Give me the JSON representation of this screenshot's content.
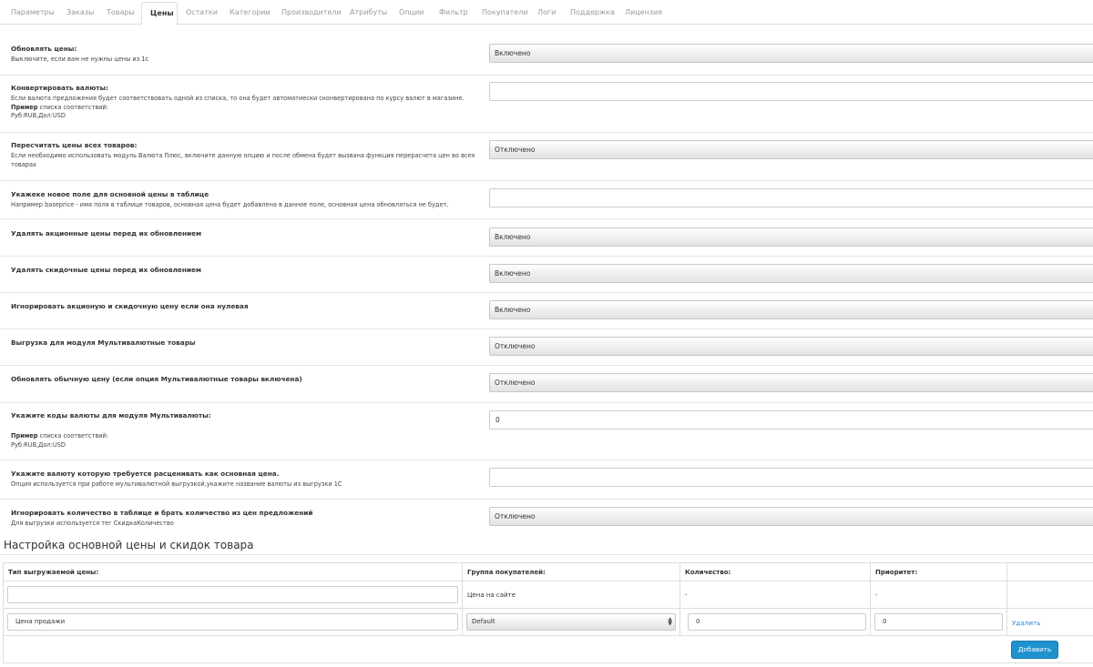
{
  "tabs": [
    "Параметры",
    "Заказы",
    "Товары",
    "Цены",
    "Остатки",
    "Категории",
    "Производители",
    "Атрибуты",
    "Опции",
    "Фильтр",
    "Покупатели",
    "Логи",
    "Поддержка",
    "Лицензия"
  ],
  "active_tab": "Цены",
  "settings": [
    {
      "label": "Обновлять цены:",
      "help": "Выключите, если вам не нужны цены из 1с",
      "control": "select",
      "value": "Включено"
    },
    {
      "label": "Конвертировать валюты:",
      "help": "Если валюта предложения будет соответствовать одной из списка, то она будет автоматиески сконвертирована по курсу валют в магазине.",
      "example_label": "Пример",
      "example_text": "списка соответствий:",
      "example_value": "Руб:RUB,Дол:USD",
      "control": "input",
      "value": ""
    },
    {
      "label": "Пересчитать цены всех товаров:",
      "help": "Если необходимо использовать модуль Валюта Плюс, включите данную опцию и после обмена будет вызвана функция перерасчета цен во всех товарах",
      "control": "select",
      "value": "Отключено"
    },
    {
      "label": "Укажеке новое поле для основной цены в таблице",
      "help": "Например baseprice - имя поля в таблице товаров, основная цена будет добавлена в данное поле, основная цена обновляться не будет.",
      "control": "input",
      "value": ""
    },
    {
      "label": "Удалять акционные цены перед их обновлением",
      "control": "select",
      "value": "Включено"
    },
    {
      "label": "Удалять скидочные цены перед их обновлением",
      "control": "select",
      "value": "Включено"
    },
    {
      "label": "Игнорировать акционую и скидочную цену если она нулевая",
      "control": "select",
      "value": "Включено"
    },
    {
      "label": "Выгрузка для модуля Мультивалютные товары",
      "control": "select",
      "value": "Отключено"
    },
    {
      "label": "Обновлять обычную цену (если опция Мультивалютные товары включена)",
      "control": "select",
      "value": "Отключено"
    },
    {
      "label": "Укажите коды валюты для модуля Мультивалюты:",
      "example_label": "Пример",
      "example_text": "списка соответствий:",
      "example_value": "Руб:RUB,Дол:USD",
      "control": "input",
      "value": "0"
    },
    {
      "label": "Укажите валюту которую требуется расценивать как основная цена.",
      "help": "Опция используется при работе мультивалютной выгрузкой,укажите название валюты из выгрузки 1С",
      "control": "input",
      "value": ""
    },
    {
      "label": "Игнорировать количество в таблице и брать количество из цен предложений",
      "help": "Для выгрузки используется тег СкидкаКоличество",
      "control": "select",
      "value": "Отключено"
    }
  ],
  "price_section": {
    "title": "Настройка основной цены и скидок товара",
    "columns": [
      "Тип выгружаемой цены:",
      "Группа покупателей:",
      "Количество:",
      "Приоритет:"
    ],
    "rows": [
      {
        "type": "",
        "group": "Цена на сайте",
        "quantity": "-",
        "priority": "-"
      },
      {
        "type": "Цена продажи",
        "group": "Default",
        "quantity": "0",
        "priority": "0",
        "delete_label": "Удалить"
      }
    ],
    "add_button": "Добавить"
  },
  "colors": {
    "accent": "#1e91cf",
    "link": "#1e88e5",
    "border": "#dddddd"
  }
}
